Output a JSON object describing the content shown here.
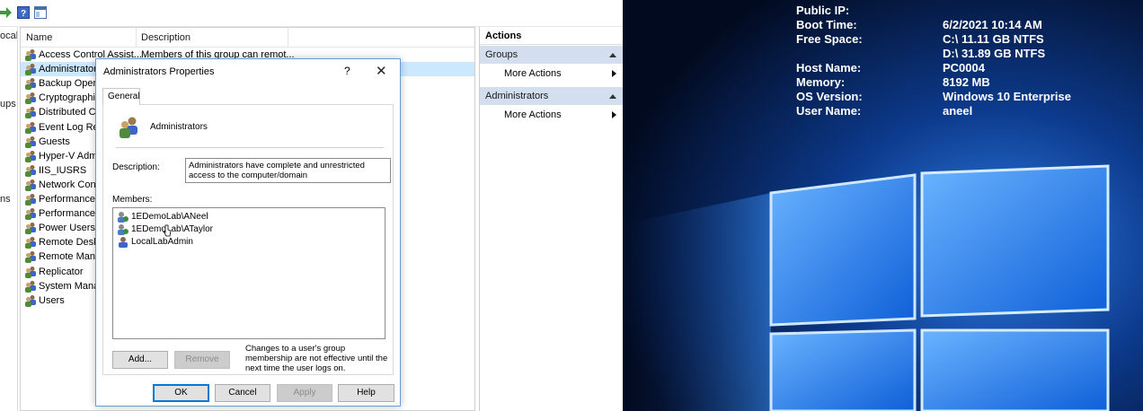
{
  "tree_fragments": [
    "ocal",
    "ups",
    "ns"
  ],
  "list": {
    "columns": [
      "Name",
      "Description"
    ],
    "rows": [
      {
        "name": "Access Control Assist...",
        "desc": "Members of this group can remot..."
      },
      {
        "name": "Administrators",
        "desc": ""
      },
      {
        "name": "Backup Opera",
        "desc": ""
      },
      {
        "name": "Cryptographic",
        "desc": ""
      },
      {
        "name": "Distributed CO",
        "desc": ""
      },
      {
        "name": "Event Log Rea",
        "desc": ""
      },
      {
        "name": "Guests",
        "desc": ""
      },
      {
        "name": "Hyper-V Admi",
        "desc": ""
      },
      {
        "name": "IIS_IUSRS",
        "desc": ""
      },
      {
        "name": "Network Conf",
        "desc": ""
      },
      {
        "name": "Performance L",
        "desc": ""
      },
      {
        "name": "Performance M",
        "desc": ""
      },
      {
        "name": "Power Users",
        "desc": ""
      },
      {
        "name": "Remote Deskt",
        "desc": ""
      },
      {
        "name": "Remote Mana",
        "desc": ""
      },
      {
        "name": "Replicator",
        "desc": ""
      },
      {
        "name": "System Manag",
        "desc": ""
      },
      {
        "name": "Users",
        "desc": ""
      }
    ]
  },
  "actions": {
    "title": "Actions",
    "sections": [
      {
        "label": "Groups",
        "item": "More Actions"
      },
      {
        "label": "Administrators",
        "item": "More Actions"
      }
    ]
  },
  "dialog": {
    "title": "Administrators Properties",
    "help": "?",
    "close": "✕",
    "tab": "General",
    "group_name": "Administrators",
    "description_label": "Description:",
    "description": "Administrators have complete and unrestricted access to the computer/domain",
    "members_label": "Members:",
    "members": [
      "1EDemoLab\\ANeel",
      "1EDemoLab\\ATaylor",
      "LocalLabAdmin"
    ],
    "add": "Add...",
    "remove": "Remove",
    "note": "Changes to a user's group membership are not effective until the next time the user logs on.",
    "ok": "OK",
    "cancel": "Cancel",
    "apply": "Apply",
    "help_button": "Help"
  },
  "desktop_info": [
    {
      "key": "Public IP:",
      "value": ""
    },
    {
      "key": "Boot Time:",
      "value": "6/2/2021 10:14 AM"
    },
    {
      "key": "Free Space:",
      "value": "C:\\ 11.11 GB NTFS"
    },
    {
      "key": "",
      "value": "D:\\ 31.89 GB NTFS"
    },
    {
      "key": "Host Name:",
      "value": "PC0004"
    },
    {
      "key": "Memory:",
      "value": "8192 MB"
    },
    {
      "key": "OS Version:",
      "value": "Windows 10 Enterprise"
    },
    {
      "key": "User Name:",
      "value": "aneel"
    }
  ],
  "colors": {
    "selection": "#cce8ff",
    "actions_section": "#d3dfee",
    "desktop_bg": "#020b22",
    "windows_blue": "#1e8cff"
  }
}
